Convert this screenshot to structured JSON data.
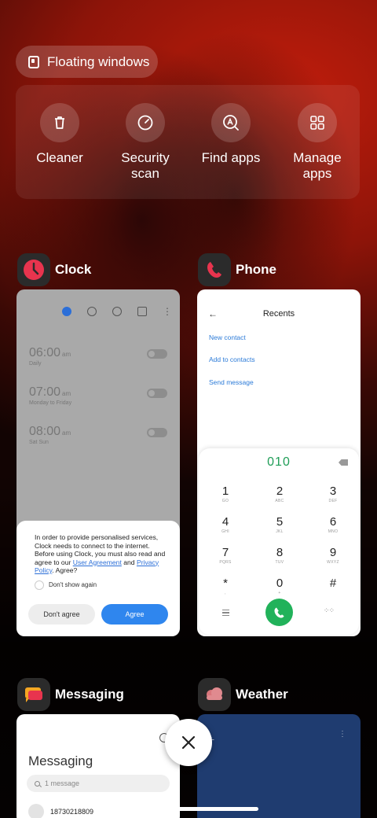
{
  "floating_windows": {
    "label": "Floating windows",
    "icon": "floating-window-icon"
  },
  "quick_actions": [
    {
      "label": "Cleaner",
      "icon": "trash-icon"
    },
    {
      "label": "Security scan",
      "icon": "security-gauge-icon"
    },
    {
      "label": "Find apps",
      "icon": "find-apps-icon"
    },
    {
      "label": "Manage apps",
      "icon": "grid-apps-icon"
    }
  ],
  "clock": {
    "app_name": "Clock",
    "icon": "clock-app-icon",
    "toolbar_icons": [
      "alarm-icon",
      "clock-icon",
      "stopwatch-icon",
      "timer-icon",
      "more-icon"
    ],
    "alarms": [
      {
        "time": "06:00",
        "ampm": "am",
        "repeat": "Daily"
      },
      {
        "time": "07:00",
        "ampm": "am",
        "repeat": "Monday to Friday"
      },
      {
        "time": "08:00",
        "ampm": "am",
        "repeat": "Sat Sun"
      }
    ],
    "consent": {
      "text_1": "In order to provide personalised services, Clock needs to connect to the internet. Before using Clock, you must also read and agree to our ",
      "link_agreement": "User Agreement",
      "text_and": " and ",
      "link_privacy": "Privacy Policy",
      "text_end": ". Agree?",
      "checkbox_label": "Don't show again",
      "disagree": "Don't agree",
      "agree": "Agree"
    }
  },
  "phone": {
    "app_name": "Phone",
    "icon": "phone-app-icon",
    "title": "Recents",
    "links": [
      "New contact",
      "Add to contacts",
      "Send message"
    ],
    "dialed_number": "010",
    "keys": [
      {
        "num": "1",
        "letters": "GO"
      },
      {
        "num": "2",
        "letters": "ABC"
      },
      {
        "num": "3",
        "letters": "DEF"
      },
      {
        "num": "4",
        "letters": "GHI"
      },
      {
        "num": "5",
        "letters": "JKL"
      },
      {
        "num": "6",
        "letters": "MNO"
      },
      {
        "num": "7",
        "letters": "PQRS"
      },
      {
        "num": "8",
        "letters": "TUV"
      },
      {
        "num": "9",
        "letters": "WXYZ"
      },
      {
        "num": "*",
        "letters": ","
      },
      {
        "num": "0",
        "letters": "+"
      },
      {
        "num": "#",
        "letters": ""
      }
    ]
  },
  "messaging": {
    "app_name": "Messaging",
    "icon": "messaging-app-icon",
    "title": "Messaging",
    "search_placeholder": "1 message",
    "sender": "18730218809"
  },
  "weather": {
    "app_name": "Weather",
    "icon": "weather-app-icon"
  },
  "close_icon": "close-icon"
}
